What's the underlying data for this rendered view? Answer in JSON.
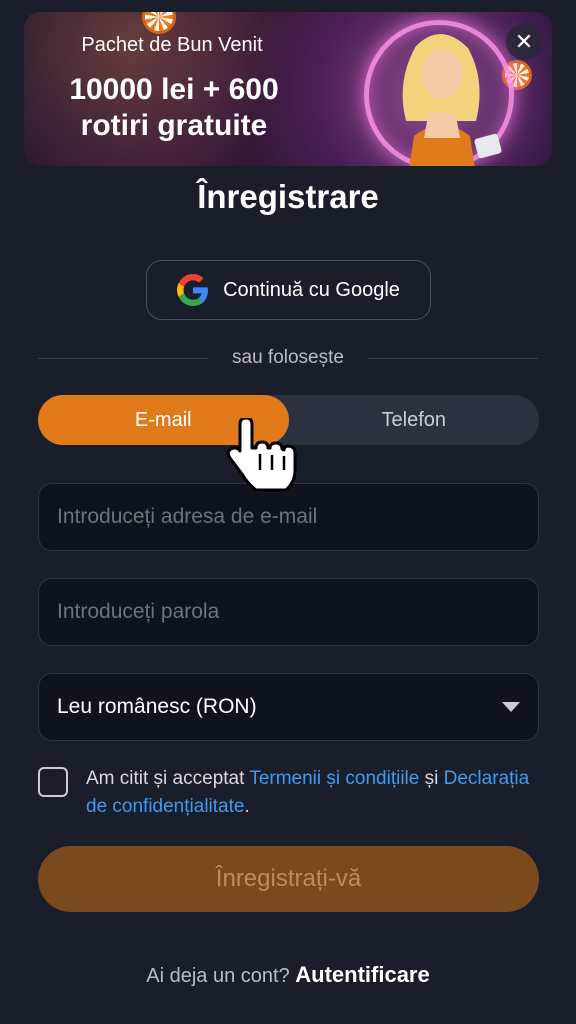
{
  "banner": {
    "subtitle": "Pachet de Bun Venit",
    "title_line1": "10000 lei + 600",
    "title_line2": "rotiri gratuite",
    "close_symbol": "✕"
  },
  "page_title": "Înregistrare",
  "google_button": {
    "label": "Continuă cu Google",
    "icon": "google-icon"
  },
  "divider_text": "sau folosește",
  "tabs": [
    {
      "label": "E-mail",
      "active": true
    },
    {
      "label": "Telefon",
      "active": false
    }
  ],
  "email_field": {
    "value": "",
    "placeholder": "Introduceți adresa de e-mail"
  },
  "password_field": {
    "value": "",
    "placeholder": "Introduceți parola"
  },
  "currency_select": {
    "value": "Leu românesc (RON)"
  },
  "terms": {
    "checked": false,
    "text_before": "Am citit și acceptat ",
    "link_terms": "Termenii și condițiile",
    "text_middle": " și ",
    "link_privacy": "Declarația de confidențialitate",
    "text_after": "."
  },
  "submit_button": {
    "label": "Înregistrați-vă"
  },
  "footer": {
    "question": "Ai deja un cont?",
    "login_link": "Autentificare"
  },
  "colors": {
    "background": "#1a1e2b",
    "accent": "#e07a1a",
    "submit_disabled": "#7a4a1f",
    "link": "#3d9bf2"
  }
}
